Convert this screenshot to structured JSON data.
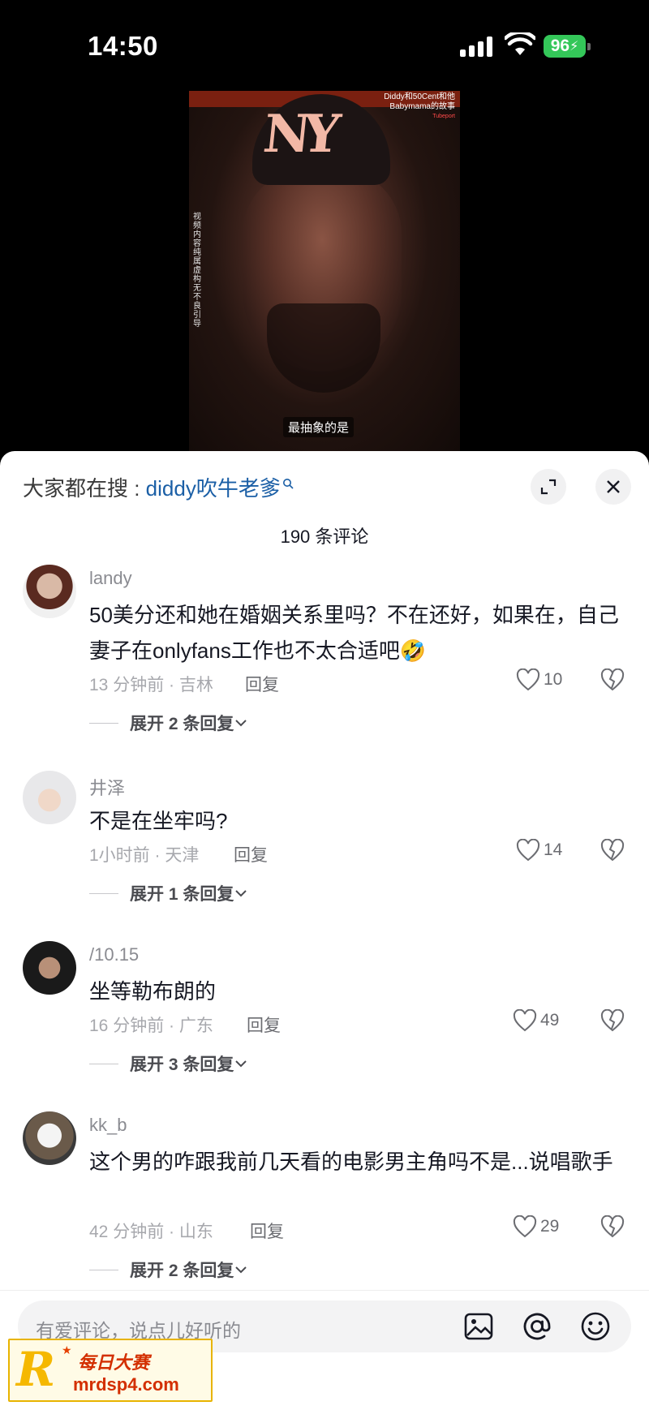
{
  "status_bar": {
    "time": "14:50",
    "battery": "96"
  },
  "video": {
    "top_caption_line1": "Diddy和50Cent和他",
    "top_caption_line2": "Babymama的故事",
    "logo_text": "Tubeport",
    "cap_logo": "NY",
    "vertical_notice": "视频内容纯属虚构 无不良引导",
    "subtitle": "最抽象的是"
  },
  "sheet": {
    "search_prefix": "大家都在搜 : ",
    "search_term": "diddy吹牛老爹",
    "comment_count": "190 条评论"
  },
  "comments": [
    {
      "username": "landy",
      "text": "50美分还和她在婚姻关系里吗？不在还好，如果在，自己妻子在onlyfans工作也不太合适吧🤣",
      "time_location": "13 分钟前 · 吉林",
      "reply_label": "回复",
      "likes": "10",
      "expand_label": "展开 2 条回复"
    },
    {
      "username": "井泽",
      "text": "不是在坐牢吗?",
      "time_location": "1小时前 · 天津",
      "reply_label": "回复",
      "likes": "14",
      "expand_label": "展开 1 条回复"
    },
    {
      "username": "/10.15",
      "text": "坐等勒布朗的",
      "time_location": "16 分钟前 · 广东",
      "reply_label": "回复",
      "likes": "49",
      "expand_label": "展开 3 条回复"
    },
    {
      "username": "kk_b",
      "text": "这个男的咋跟我前几天看的电影男主角吗不是...说唱歌手",
      "time_location": "42 分钟前 · 山东",
      "reply_label": "回复",
      "likes": "29",
      "expand_label": "展开 2 条回复"
    }
  ],
  "input": {
    "placeholder": "有爱评论，说点儿好听的"
  },
  "watermark": {
    "letter": "R",
    "cn": "每日大赛",
    "url": "mrdsp4.com"
  },
  "colors": {
    "accent_link": "#1b5fa6",
    "battery": "#34c759",
    "watermark": "#d32f00"
  }
}
